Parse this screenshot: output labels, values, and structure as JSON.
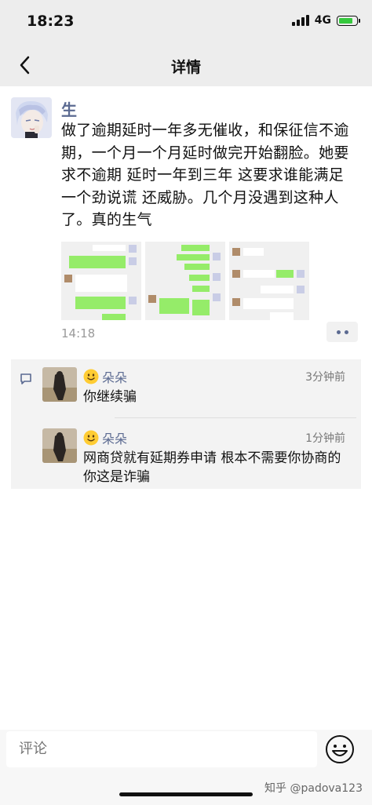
{
  "status_bar": {
    "time": "18:23",
    "network": "4G"
  },
  "nav": {
    "title": "详情",
    "back_icon": "chevron-left-icon"
  },
  "post": {
    "author": "生",
    "text": "做了逾期延时一年多无催收，和保征信不逾期，一个月一个月延时做完开始翻脸。她要求不逾期 延时一年到三年 这要求谁能满足 一个劲说谎 还威胁。几个月没遇到这种人了。真的生气",
    "time": "14:18",
    "images": [
      "chat-screenshot-1",
      "chat-screenshot-2",
      "chat-screenshot-3"
    ]
  },
  "comments": [
    {
      "name": "朵朵",
      "time": "3分钟前",
      "text": "你继续骗"
    },
    {
      "name": "朵朵",
      "time": "1分钟前",
      "text": "网商贷就有延期券申请 根本不需要你协商的 你这是诈骗"
    }
  ],
  "input": {
    "placeholder": "评论"
  },
  "watermark": "知乎 @padova123",
  "colors": {
    "name": "#5b6a91",
    "background": "#ededed",
    "bubble_green": "#95ec69"
  }
}
